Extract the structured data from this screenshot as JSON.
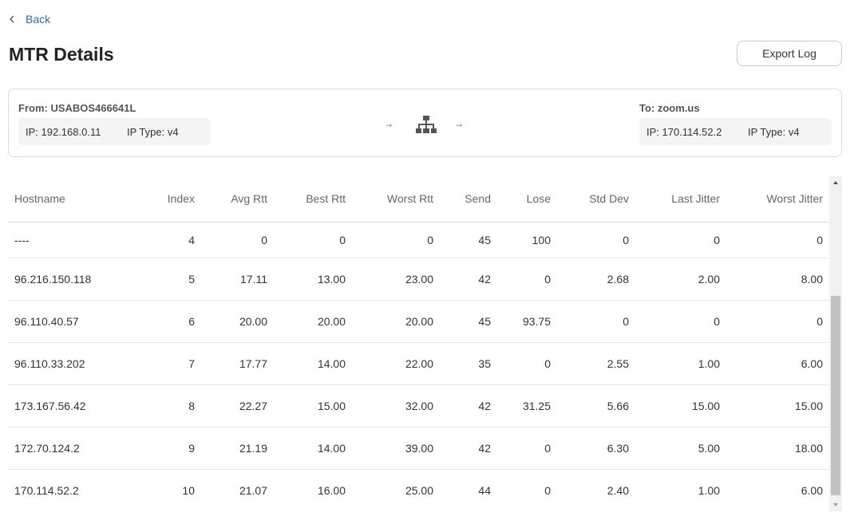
{
  "nav": {
    "back_label": "Back"
  },
  "header": {
    "title": "MTR Details",
    "export_label": "Export Log"
  },
  "route": {
    "from": {
      "title": "From: USABOS466641L",
      "ip": "IP: 192.168.0.11",
      "ip_type": "IP Type: v4"
    },
    "to": {
      "title": "To: zoom.us",
      "ip": "IP: 170.114.52.2",
      "ip_type": "IP Type: v4"
    },
    "arrow": "→",
    "icon": "network-topology-icon"
  },
  "table": {
    "columns": [
      "Hostname",
      "Index",
      "Avg Rtt",
      "Best Rtt",
      "Worst Rtt",
      "Send",
      "Lose",
      "Std Dev",
      "Last Jitter",
      "Worst Jitter"
    ],
    "rows": [
      [
        "----",
        "4",
        "0",
        "0",
        "0",
        "45",
        "100",
        "0",
        "0",
        "0"
      ],
      [
        "96.216.150.118",
        "5",
        "17.11",
        "13.00",
        "23.00",
        "42",
        "0",
        "2.68",
        "2.00",
        "8.00"
      ],
      [
        "96.110.40.57",
        "6",
        "20.00",
        "20.00",
        "20.00",
        "45",
        "93.75",
        "0",
        "0",
        "0"
      ],
      [
        "96.110.33.202",
        "7",
        "17.77",
        "14.00",
        "22.00",
        "35",
        "0",
        "2.55",
        "1.00",
        "6.00"
      ],
      [
        "173.167.56.42",
        "8",
        "22.27",
        "15.00",
        "32.00",
        "42",
        "31.25",
        "5.66",
        "15.00",
        "15.00"
      ],
      [
        "172.70.124.2",
        "9",
        "21.19",
        "14.00",
        "39.00",
        "42",
        "0",
        "6.30",
        "5.00",
        "18.00"
      ],
      [
        "170.114.52.2",
        "10",
        "21.07",
        "16.00",
        "25.00",
        "44",
        "0",
        "2.40",
        "1.00",
        "6.00"
      ]
    ]
  },
  "colors": {
    "link": "#2a6db5",
    "border": "#dcdcdc",
    "box_bg": "#f4f4f4"
  }
}
